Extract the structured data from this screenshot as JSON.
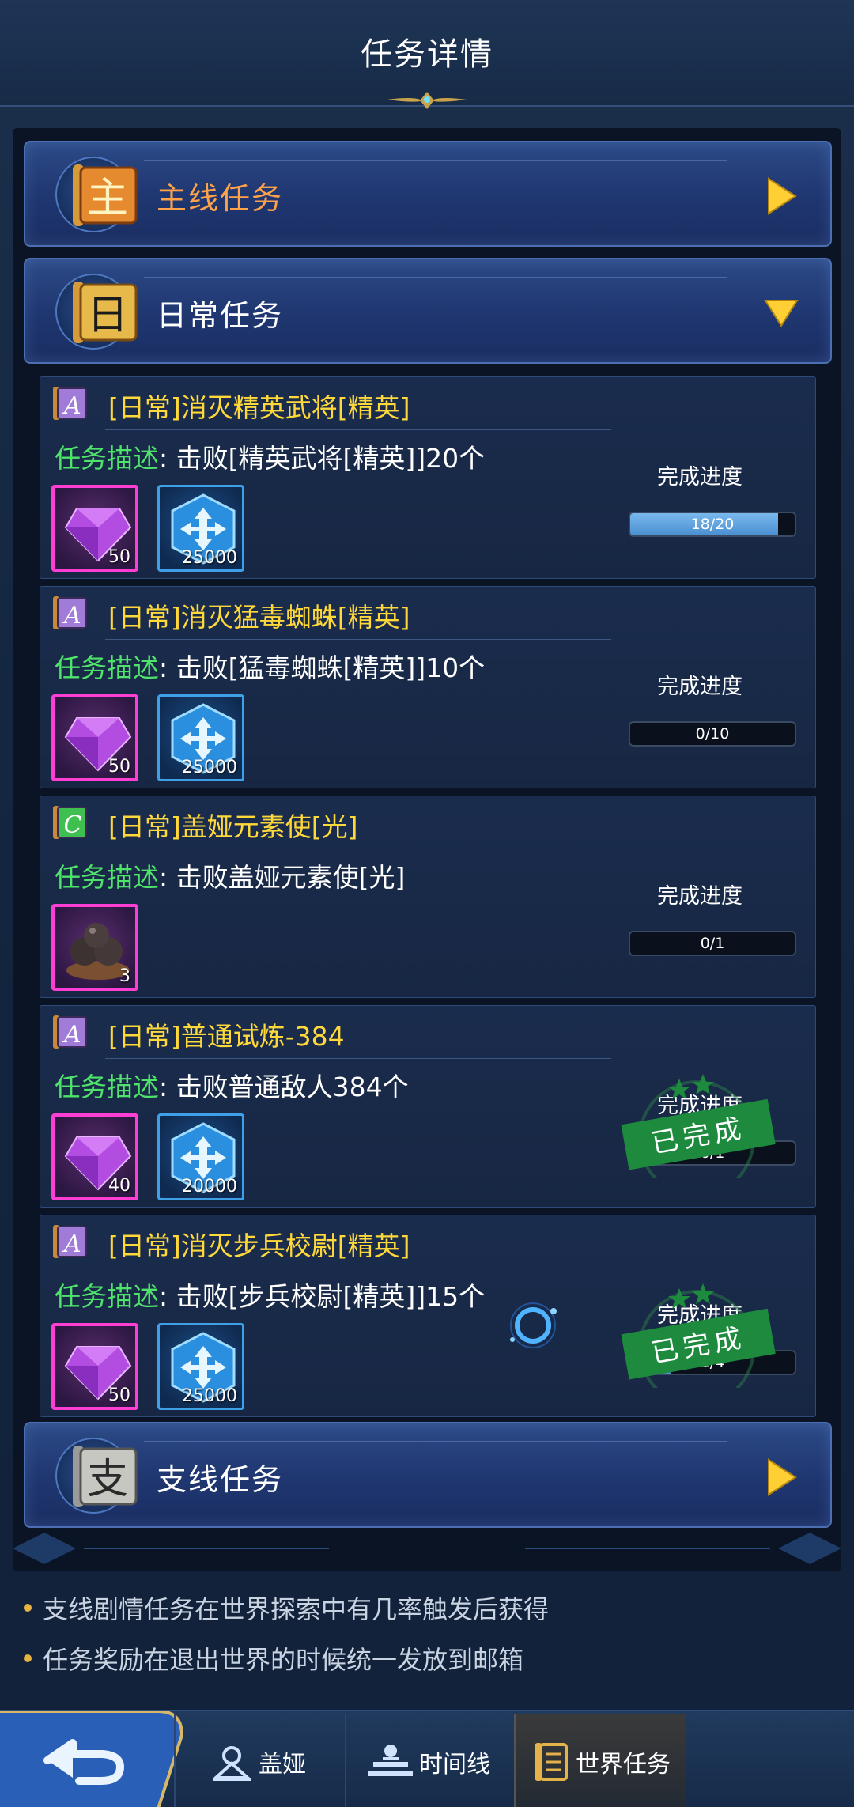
{
  "header": {
    "title": "任务详情"
  },
  "categories": {
    "main": {
      "label": "主线任务",
      "badge": "主"
    },
    "daily": {
      "label": "日常任务",
      "badge": "日"
    },
    "side": {
      "label": "支线任务",
      "badge": "支"
    }
  },
  "desc_label": "任务描述",
  "progress_label": "完成进度",
  "tasks": [
    {
      "grade": "A",
      "title": "[日常]消灭精英武将[精英]",
      "desc": "击败[精英武将[精英]]20个",
      "rewards": [
        {
          "type": "purple-gem",
          "qty": "50"
        },
        {
          "type": "blue-crystal",
          "qty": "25000"
        }
      ],
      "progress_text": "18/20",
      "progress_fraction": 0.9,
      "completed": false
    },
    {
      "grade": "A",
      "title": "[日常]消灭猛毒蜘蛛[精英]",
      "desc": "击败[猛毒蜘蛛[精英]]10个",
      "rewards": [
        {
          "type": "purple-gem",
          "qty": "50"
        },
        {
          "type": "blue-crystal",
          "qty": "25000"
        }
      ],
      "progress_text": "0/10",
      "progress_fraction": 0,
      "completed": false
    },
    {
      "grade": "C",
      "title": "[日常]盖娅元素使[光]",
      "desc": "击败盖娅元素使[光]",
      "rewards": [
        {
          "type": "iron-balls",
          "qty": "3"
        }
      ],
      "progress_text": "0/1",
      "progress_fraction": 0,
      "completed": false
    },
    {
      "grade": "A",
      "title": "[日常]普通试炼-384",
      "desc": "击败普通敌人384个",
      "rewards": [
        {
          "type": "purple-gem",
          "qty": "40"
        },
        {
          "type": "blue-crystal",
          "qty": "20000"
        }
      ],
      "progress_text": "0/1",
      "progress_fraction": 0,
      "completed": true,
      "stamp": "已完成"
    },
    {
      "grade": "A",
      "title": "[日常]消灭步兵校尉[精英]",
      "desc": "击败[步兵校尉[精英]]15个",
      "rewards": [
        {
          "type": "purple-gem",
          "qty": "50"
        },
        {
          "type": "blue-crystal",
          "qty": "25000"
        }
      ],
      "progress_text": "1/4",
      "progress_fraction": 0.25,
      "completed": true,
      "stamp": "已完成"
    }
  ],
  "notes": [
    "支线剧情任务在世界探索中有几率触发后获得",
    "任务奖励在退出世界的时候统一发放到邮箱"
  ],
  "nav": {
    "back_icon": "back-arrow-icon",
    "tabs": [
      {
        "label": "盖娅",
        "icon": "gaia-icon",
        "active": false
      },
      {
        "label": "时间线",
        "icon": "timeline-icon",
        "active": false
      },
      {
        "label": "世界任务",
        "icon": "scroll-icon",
        "active": true
      }
    ]
  },
  "colors": {
    "task_title": "#ffd83a",
    "desc_label": "#4fe36b",
    "accent_gold": "#ffcf33",
    "stamp_green": "#1d8a3e"
  }
}
